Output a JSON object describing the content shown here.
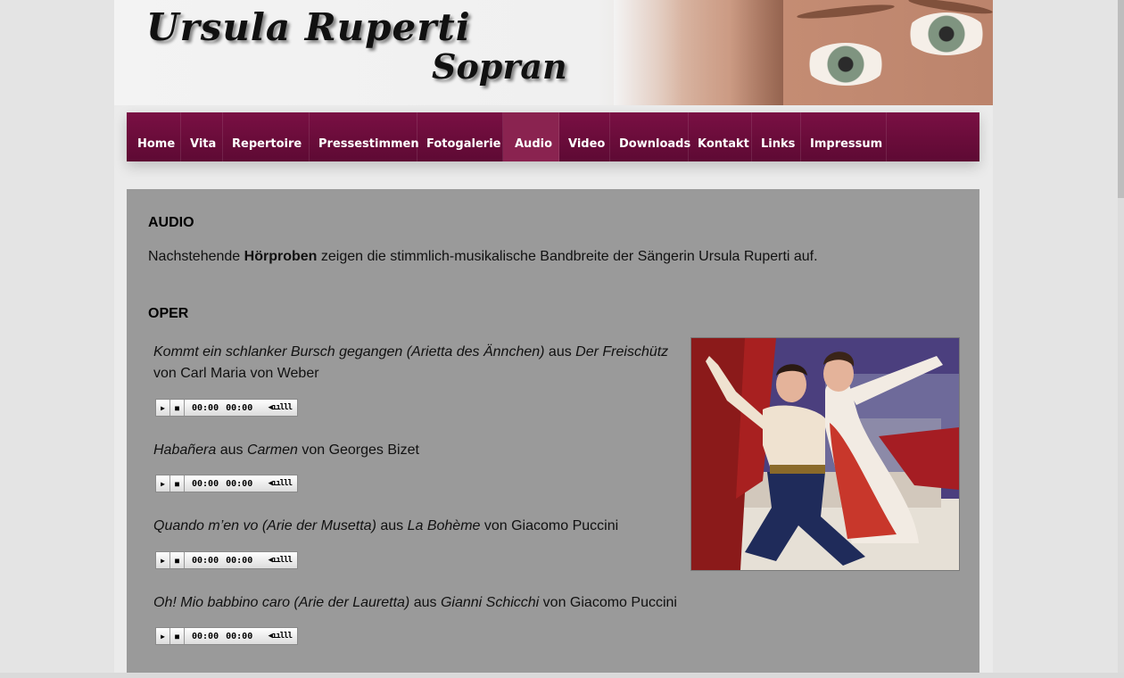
{
  "header": {
    "title_name": "Ursula Ruperti",
    "title_sub": "Sopran"
  },
  "nav": {
    "items": [
      {
        "label": "Home"
      },
      {
        "label": "Vita"
      },
      {
        "label": "Repertoire"
      },
      {
        "label": "Pressestimmen"
      },
      {
        "label": "Fotogalerie"
      },
      {
        "label": "Audio",
        "active": true
      },
      {
        "label": "Video"
      },
      {
        "label": "Downloads"
      },
      {
        "label": "Kontakt"
      },
      {
        "label": "Links"
      },
      {
        "label": "Impressum"
      }
    ]
  },
  "content": {
    "heading": "AUDIO",
    "intro_pre": "Nachstehende ",
    "intro_bold": "Hörproben",
    "intro_post": " zeigen die stimmlich-musikalische Bandbreite der Sängerin Ursula Ruperti auf.",
    "section": "OPER",
    "tracks": [
      {
        "title": "Kommt ein schlanker Bursch gegangen (Arietta des Ännchen)",
        "aus": " aus ",
        "work": "Der Freischütz",
        "composer_line": "von Carl Maria von Weber"
      },
      {
        "title": "Habañera",
        "aus": " aus ",
        "work": "Carmen",
        "composer_line": " von Georges Bizet"
      },
      {
        "title": "Quando m’en vo (Arie der Musetta)",
        "aus": " aus ",
        "work": "La Bohème",
        "composer_line": " von Giacomo Puccini"
      },
      {
        "title": "Oh! Mio babbino caro (Arie der Lauretta)",
        "aus": " aus ",
        "work": "Gianni Schicchi",
        "composer_line": " von Giacomo Puccini"
      }
    ],
    "player": {
      "play_icon": "play-icon",
      "stop_icon": "stop-icon",
      "current_time": "00:00",
      "total_time": "00:00",
      "volume_icon": "volume-icon"
    }
  },
  "colors": {
    "nav_bg": "#6a0c3a",
    "nav_active": "#8a2350",
    "content_bg": "#9a9a9a"
  }
}
